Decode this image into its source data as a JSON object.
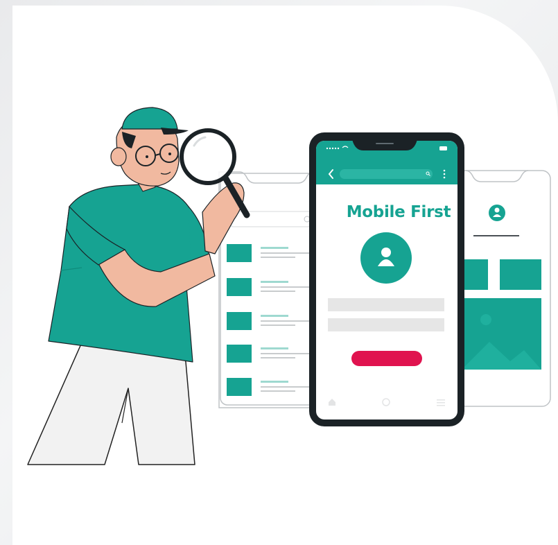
{
  "illustration": {
    "headline": "Mobile First",
    "colors": {
      "teal": "#16a392",
      "teal_dark": "#0f8c7c",
      "skin": "#f1b9a0",
      "phone_frame": "#1b2226",
      "cta_red": "#e0134f",
      "line_gray": "#e6e6e6",
      "background": "#ffffff"
    },
    "icons": [
      "back-arrow-icon",
      "search-icon",
      "more-vertical-icon",
      "user-avatar-icon",
      "home-icon",
      "circle-nav-icon",
      "menu-icon",
      "magnifying-glass-icon"
    ]
  }
}
